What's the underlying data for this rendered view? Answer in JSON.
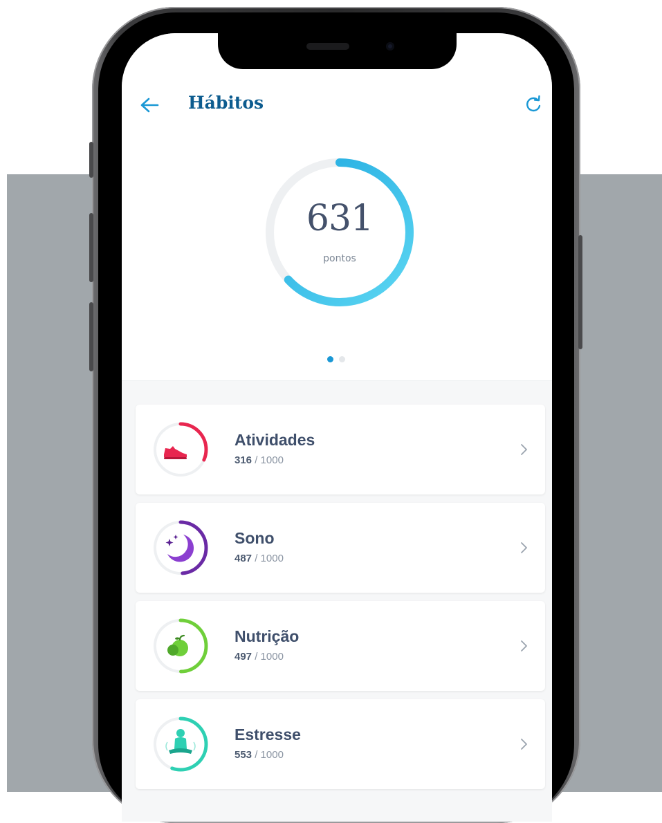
{
  "header": {
    "title": "Hábitos",
    "back_icon": "arrow-left-icon",
    "refresh_icon": "refresh-icon"
  },
  "score": {
    "value": "631",
    "label": "pontos",
    "max": 1000
  },
  "pager": {
    "current": 1,
    "total": 2
  },
  "habits": [
    {
      "name": "Atividades",
      "score": "316",
      "total": "1000",
      "icon": "sneaker-icon",
      "color": "#e8264f"
    },
    {
      "name": "Sono",
      "score": "487",
      "total": "1000",
      "icon": "moon-stars-icon",
      "color": "#6a2aa5"
    },
    {
      "name": "Nutrição",
      "score": "497",
      "total": "1000",
      "icon": "apple-icon",
      "color": "#6fcf3a"
    },
    {
      "name": "Estresse",
      "score": "553",
      "total": "1000",
      "icon": "meditation-icon",
      "color": "#2ed0b3"
    }
  ],
  "colors": {
    "title": "#0d5c8f",
    "accent": "#1a98d5",
    "ring_start": "#1fa9e0",
    "ring_end": "#5cd6f2",
    "backdrop": "#a1a7ab"
  }
}
